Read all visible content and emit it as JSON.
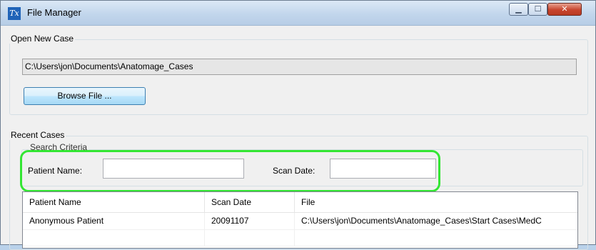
{
  "window": {
    "title": "File Manager",
    "app_icon_text": "Tx",
    "controls": {
      "minimize": "▁",
      "maximize": "☐",
      "close": "✕"
    }
  },
  "open_case": {
    "legend": "Open New Case",
    "path_value": "C:\\Users\\jon\\Documents\\Anatomage_Cases",
    "browse_label": "Browse File ..."
  },
  "recent_cases": {
    "legend": "Recent Cases",
    "search": {
      "legend": "Search Criteria",
      "patient_name_label": "Patient Name:",
      "patient_name_value": "",
      "scan_date_label": "Scan Date:",
      "scan_date_value": ""
    },
    "table": {
      "columns": [
        "Patient Name",
        "Scan Date",
        "File"
      ],
      "rows": [
        [
          "Anonymous Patient",
          "20091107",
          "C:\\Users\\jon\\Documents\\Anatomage_Cases\\Start Cases\\MedC"
        ],
        [
          "",
          "",
          ""
        ]
      ]
    }
  },
  "colors": {
    "highlight": "#33e633",
    "button_border": "#3c7fb1"
  }
}
